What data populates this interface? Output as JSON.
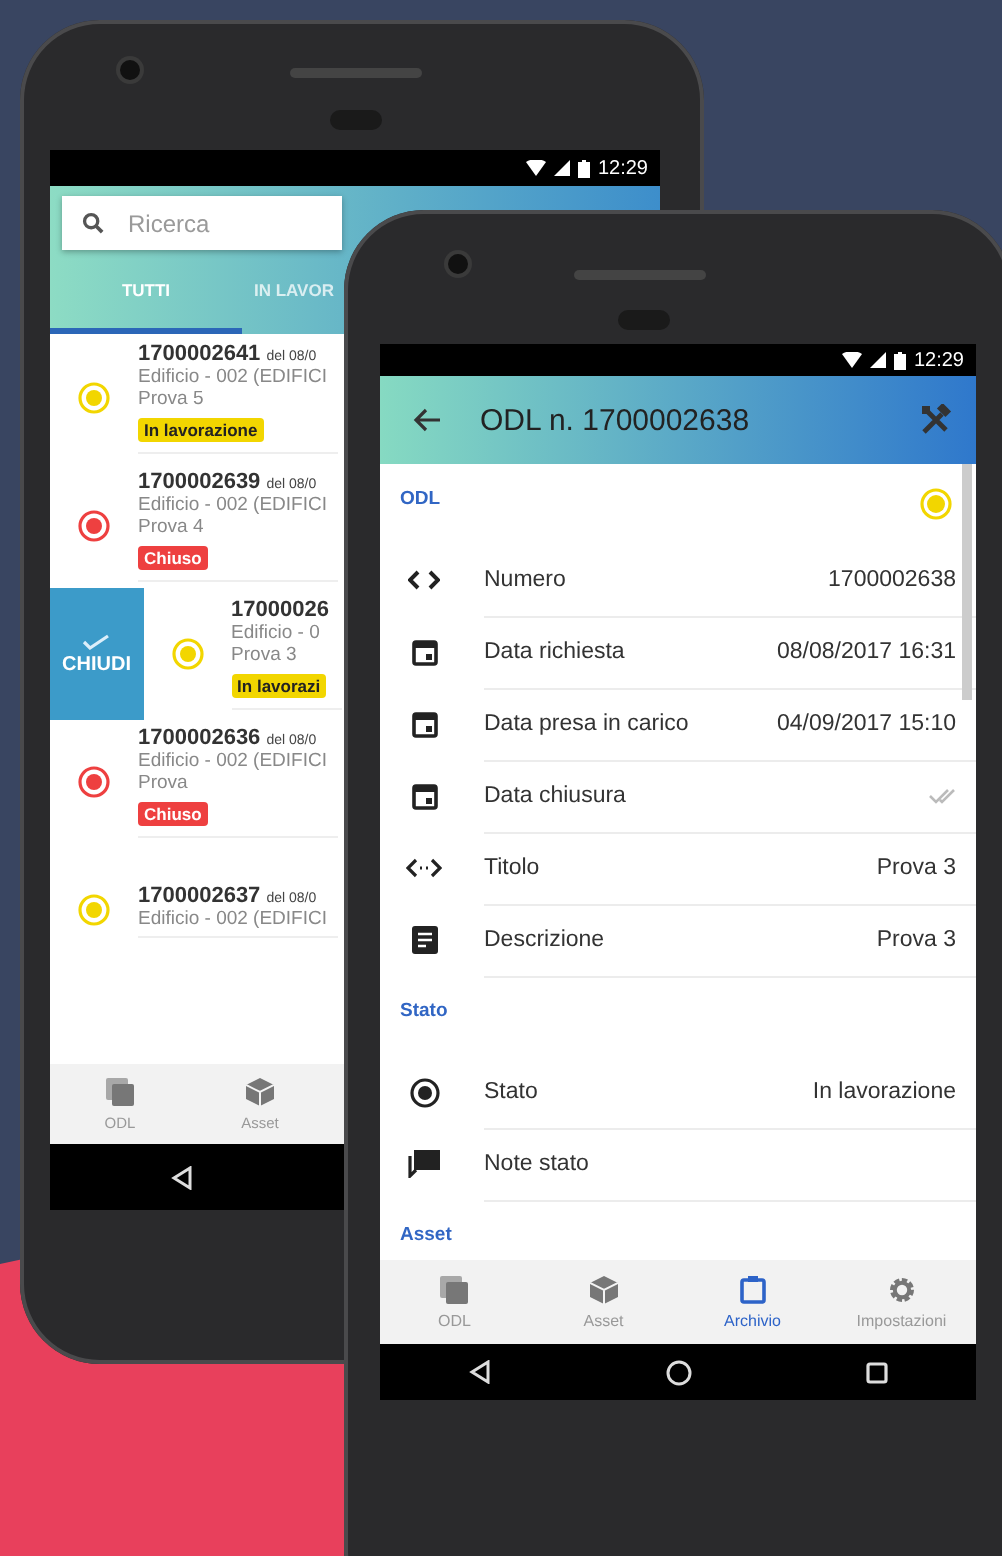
{
  "list_phone": {
    "time": "12:29",
    "search": {
      "placeholder": "Ricerca"
    },
    "tabs": [
      {
        "label": "TUTTI",
        "selected": true
      },
      {
        "label": "IN LAVOR",
        "selected": false
      }
    ],
    "swipe_action": "CHIUDI",
    "items": [
      {
        "number": "1700002641",
        "date": "del 08/0",
        "location": "Edificio - 002 (EDIFICI",
        "title": "Prova 5",
        "status": "In lavorazione",
        "color": "#f2d600",
        "swiped": false
      },
      {
        "number": "1700002639",
        "date": "del 08/0",
        "location": "Edificio - 002 (EDIFICI",
        "title": "Prova 4",
        "status": "Chiuso",
        "color": "#ee4040",
        "swiped": false
      },
      {
        "number": "17000026",
        "location": "Edificio - 0",
        "title": "Prova 3",
        "status": "In lavorazi",
        "color": "#f2d600",
        "swiped": true
      },
      {
        "number": "1700002636",
        "date": "del 08/0",
        "location": "Edificio - 002 (EDIFICI",
        "title": "Prova",
        "status": "Chiuso",
        "color": "#ee4040",
        "swiped": false
      },
      {
        "number": "1700002637",
        "date": "del 08/0",
        "location": "Edificio - 002 (EDIFICI",
        "color": "#f2d600",
        "swiped": false
      }
    ],
    "nav": [
      {
        "label": "ODL",
        "kind": "stack",
        "selected": false
      },
      {
        "label": "Asset",
        "kind": "cube",
        "selected": false
      }
    ]
  },
  "detail_phone": {
    "time": "12:29",
    "title": "ODL n. 1700002638",
    "sections": [
      {
        "title": "ODL",
        "color": "#f2d600",
        "fields": [
          {
            "kind": "code",
            "label": "Numero",
            "value": "1700002638"
          },
          {
            "kind": "calendar",
            "label": "Data richiesta",
            "value": "08/08/2017 16:31"
          },
          {
            "kind": "calendar",
            "label": "Data presa in carico",
            "value": "04/09/2017 15:10"
          },
          {
            "kind": "calendar",
            "label": "Data chiusura",
            "checked": true
          },
          {
            "kind": "swap",
            "label": "Titolo",
            "value": "Prova 3"
          },
          {
            "kind": "notes",
            "label": "Descrizione",
            "value": "Prova 3"
          }
        ]
      },
      {
        "title": "Stato",
        "fields": [
          {
            "kind": "radio",
            "label": "Stato",
            "value": "In lavorazione"
          },
          {
            "kind": "comment",
            "label": "Note stato"
          }
        ]
      },
      {
        "title": "Asset"
      }
    ],
    "nav": [
      {
        "label": "ODL",
        "kind": "stack",
        "selected": false
      },
      {
        "label": "Asset",
        "kind": "cube",
        "selected": false
      },
      {
        "label": "Archivio",
        "kind": "clipboard",
        "selected": true
      },
      {
        "label": "Impostazioni",
        "kind": "gear",
        "selected": false
      }
    ]
  }
}
